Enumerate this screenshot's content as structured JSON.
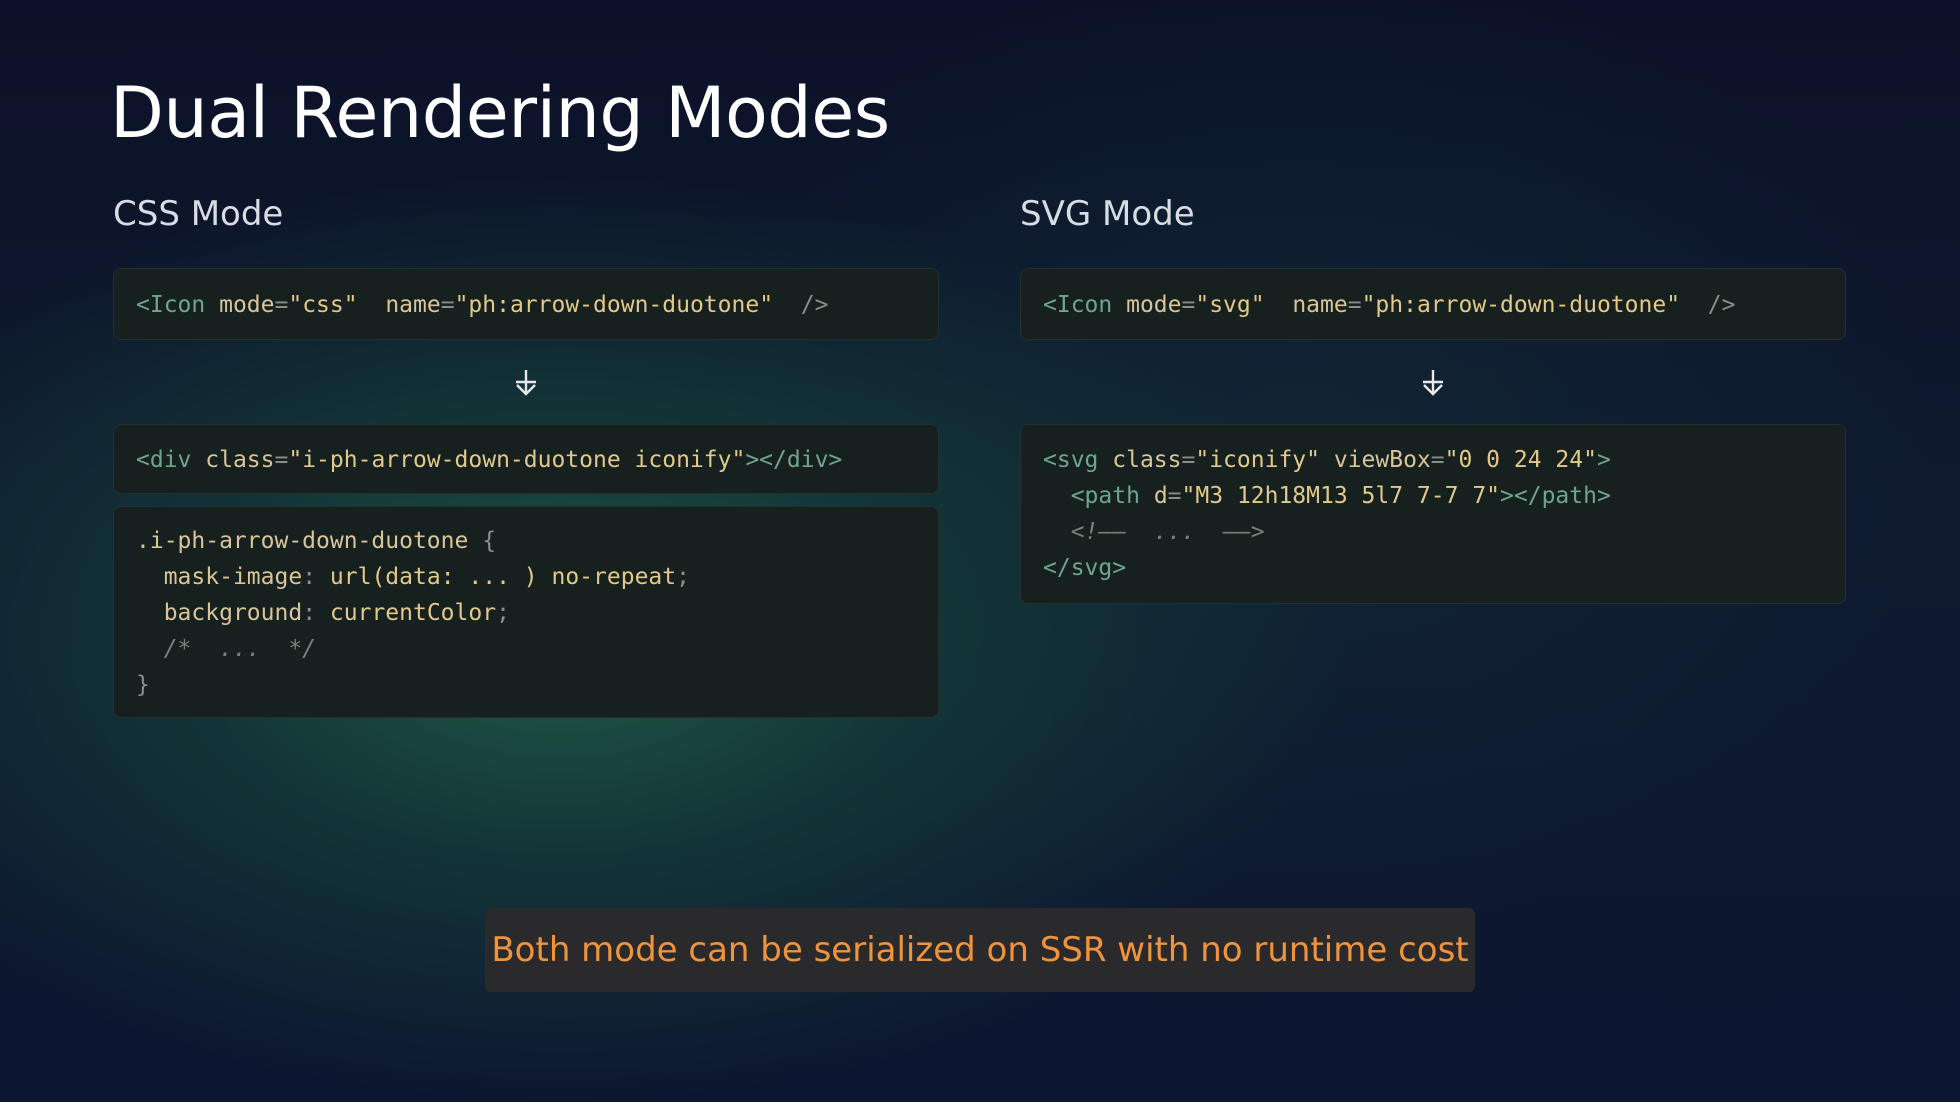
{
  "title": "Dual Rendering Modes",
  "columns": {
    "css": {
      "heading": "CSS Mode",
      "input": [
        "<Icon",
        "mode",
        "=",
        "\"css\"",
        "name",
        "=",
        "\"ph:arrow-down-duotone\"",
        "/>"
      ],
      "output_div": [
        "<div",
        "class",
        "=",
        "\"i-ph-arrow-down-duotone iconify\"",
        "></div>"
      ],
      "output_css": {
        "selector": ".i-ph-arrow-down-duotone",
        "open": "{",
        "line1_prop": "mask-image",
        "line1_val_fn": "url",
        "line1_val_arg": "(data: ... )",
        "line1_val_rest": "no-repeat",
        "line2_prop": "background",
        "line2_val": "currentColor",
        "comment": "/*  ...  */",
        "close": "}"
      }
    },
    "svg": {
      "heading": "SVG Mode",
      "input": [
        "<Icon",
        "mode",
        "=",
        "\"svg\"",
        "name",
        "=",
        "\"ph:arrow-down-duotone\"",
        "/>"
      ],
      "output": {
        "line1_tag": "<svg",
        "line1_attr1": "class",
        "line1_val1": "\"iconify\"",
        "line1_attr2": "viewBox",
        "line1_val2": "\"0 0 24 24\"",
        "line1_end": ">",
        "line2_tag": "<path",
        "line2_attr": "d",
        "line2_val": "\"M3 12h18M13 5l7 7-7 7\"",
        "line2_end": "></path>",
        "line3": "<!——  ...  ——>",
        "line4": "</svg>"
      }
    }
  },
  "callout": "Both mode can be serialized on SSR with no runtime cost",
  "icons": {
    "arrow": "arrow-down-icon"
  },
  "colors": {
    "accent": "#f0943c",
    "tag": "#6fa58e",
    "attr": "#d9c59a"
  }
}
